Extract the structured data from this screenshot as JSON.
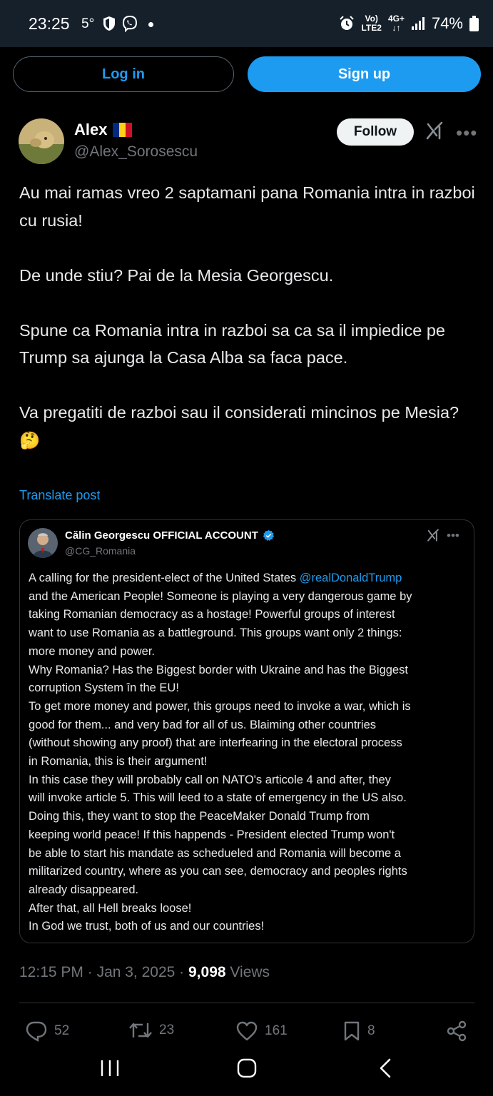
{
  "status_bar": {
    "time": "23:25",
    "temperature": "5°",
    "signal_label_top": "Vo)",
    "signal_label_bottom": "LTE2",
    "network": "4G+",
    "battery": "74%"
  },
  "auth": {
    "login_label": "Log in",
    "signup_label": "Sign up"
  },
  "author": {
    "name": "Alex",
    "handle": "@Alex_Sorosescu",
    "flag_colors": [
      "#002b7f",
      "#fcd116",
      "#ce1126"
    ]
  },
  "follow_label": "Follow",
  "tweet": {
    "paragraphs": [
      "Au mai ramas vreo 2 saptamani pana Romania intra in razboi cu rusia!",
      "De unde stiu? Pai de la Mesia Georgescu.",
      "Spune ca Romania intra in razboi sa ca sa il impiedice pe Trump sa ajunga la Casa Alba sa faca pace.",
      "Va pregatiti de razboi sau il considerati mincinos pe Mesia? 🤔"
    ],
    "translate_label": "Translate post"
  },
  "quote": {
    "name": "Călin Georgescu OFFICIAL ACCOUNT",
    "handle": "@CG_Romania",
    "line1_prefix": "A calling for the president-elect of the United States ",
    "mention": "@realDonaldTrump",
    "lines": [
      "and the American People! Someone is playing a very dangerous game by",
      "taking Romanian democracy as a hostage! Powerful groups of interest",
      "want to use Romania as a battleground. This groups want only 2 things:",
      "more money and power.",
      "Why Romania? Has the Biggest border with Ukraine and has the Biggest",
      "corruption System în the EU!",
      "To get more money and power, this groups need to invoke a war, which is",
      "good for them... and very bad for all of us. Blaiming other countries",
      "(without showing any proof) that are interfearing in the electoral process",
      "in Romania, this is their argument!",
      "In this case they will probably call on NATO's articole 4 and after, they",
      "will invoke article 5. This will leed to a state of emergency in the US also.",
      "Doing this, they want to stop the PeaceMaker Donald Trump from",
      "keeping world peace! If this happends - President elected Trump won't",
      "be able to start his mandate as schedueled and Romania will become a",
      "militarized country, where as you can see, democracy and peoples rights",
      "already disappeared.",
      "After that, all Hell breaks loose!",
      "In God we trust, both of us and our countries!"
    ]
  },
  "meta": {
    "time": "12:15 PM",
    "separator": " · ",
    "date": "Jan 3, 2025",
    "views_count": "9,098",
    "views_label": " Views"
  },
  "actions": {
    "replies": "52",
    "reposts": "23",
    "likes": "161",
    "bookmarks": "8"
  },
  "colors": {
    "accent": "#1d9bf0",
    "background": "#000000",
    "muted": "#71767b",
    "verified": "#1d9bf0"
  }
}
